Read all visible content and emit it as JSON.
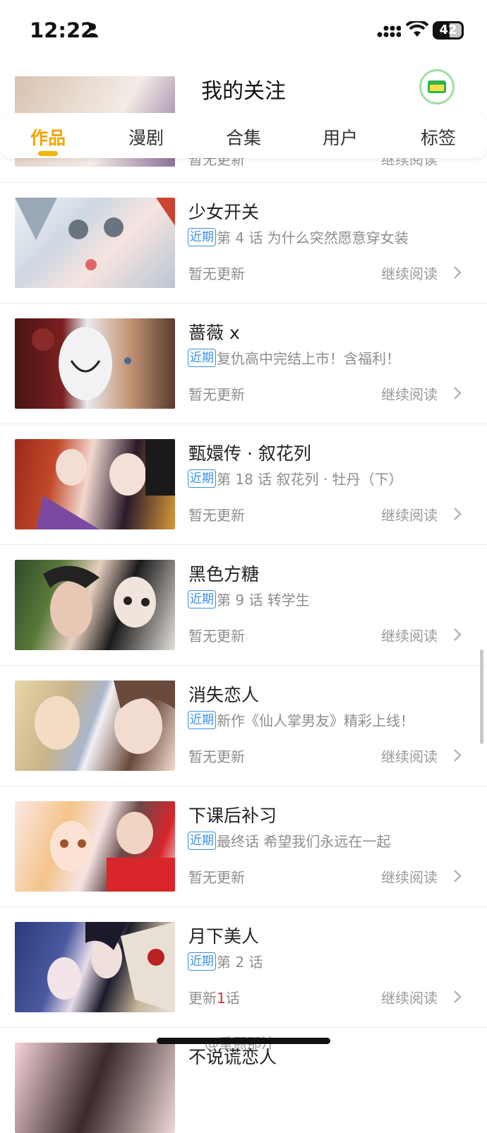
{
  "status": {
    "time": "12:22",
    "battery": "42"
  },
  "nav": {
    "title": "我的关注"
  },
  "tabs": [
    {
      "label": "作品",
      "active": true
    },
    {
      "label": "漫剧"
    },
    {
      "label": "合集"
    },
    {
      "label": "用户"
    },
    {
      "label": "标签"
    }
  ],
  "partial_top": {
    "update": "暂无更新",
    "continue": "继续阅读"
  },
  "items": [
    {
      "title": "少女开关",
      "tag": "近期",
      "subtitle": "第 4 话 为什么突然愿意穿女装",
      "update": "暂无更新",
      "continue": "继续阅读"
    },
    {
      "title": "蔷薇 x",
      "tag": "近期",
      "subtitle": "复仇高中完结上市！含福利！",
      "update": "暂无更新",
      "continue": "继续阅读"
    },
    {
      "title": "甄嬛传 · 叙花列",
      "tag": "近期",
      "subtitle": "第 18 话 叙花列 · 牡丹（下）",
      "update": "暂无更新",
      "continue": "继续阅读"
    },
    {
      "title": "黑色方糖",
      "tag": "近期",
      "subtitle": "第 9 话 转学生",
      "update": "暂无更新",
      "continue": "继续阅读"
    },
    {
      "title": "消失恋人",
      "tag": "近期",
      "subtitle": "新作《仙人掌男友》精彩上线！",
      "update": "暂无更新",
      "continue": "继续阅读"
    },
    {
      "title": "下课后补习",
      "tag": "近期",
      "subtitle": "最终话 希望我们永远在一起",
      "update": "暂无更新",
      "continue": "继续阅读"
    },
    {
      "title": "月下美人",
      "tag": "近期",
      "subtitle": "第 2 话",
      "update_prefix": "更新",
      "update_num": "1",
      "update_suffix": "话",
      "continue": "继续阅读"
    }
  ],
  "partial_bottom": {
    "title": "不说谎恋人"
  },
  "watermark": "@重熙那汁"
}
